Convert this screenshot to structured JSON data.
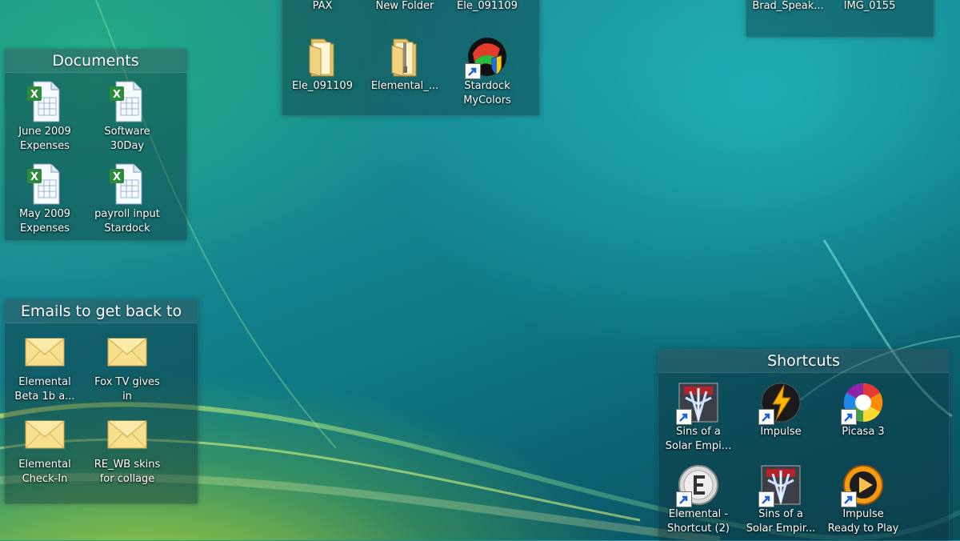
{
  "top_strip": {
    "labels": [
      "PAX",
      "New Folder",
      "Ele_091109"
    ]
  },
  "top_fence": {
    "items": [
      {
        "label": "Ele_091109",
        "icon": "folder-icon"
      },
      {
        "label": "Elemental_...",
        "icon": "zip-folder-icon"
      },
      {
        "label": "Stardock\nMyColors",
        "icon": "stardock-mycolors-icon"
      }
    ]
  },
  "top_right_fence": {
    "labels": [
      "Brad_Speak...",
      "IMG_0155"
    ]
  },
  "documents": {
    "title": "Documents",
    "items": [
      {
        "label": "June 2009\nExpenses",
        "icon": "excel-document-icon"
      },
      {
        "label": "Software\n30Day",
        "icon": "excel-document-icon"
      },
      {
        "label": "May 2009\nExpenses",
        "icon": "excel-document-icon"
      },
      {
        "label": "payroll input\nStardock",
        "icon": "excel-document-icon"
      }
    ]
  },
  "emails": {
    "title": "Emails to get back to",
    "items": [
      {
        "label": "Elemental\nBeta 1b a...",
        "icon": "envelope-icon"
      },
      {
        "label": "Fox TV gives\nin",
        "icon": "envelope-icon"
      },
      {
        "label": "Elemental\nCheck-In",
        "icon": "envelope-icon"
      },
      {
        "label": "RE_WB skins\nfor collage",
        "icon": "envelope-icon"
      }
    ]
  },
  "shortcuts": {
    "title": "Shortcuts",
    "items": [
      {
        "label": "Sins of a\nSolar Empi...",
        "icon": "sins-of-a-solar-empire-icon"
      },
      {
        "label": "Impulse",
        "icon": "impulse-icon"
      },
      {
        "label": "Picasa 3",
        "icon": "picasa-icon"
      },
      {
        "label": "Elemental -\nShortcut (2)",
        "icon": "elemental-icon"
      },
      {
        "label": "Sins of a\nSolar Empir...",
        "icon": "sins-of-a-solar-empire-icon"
      },
      {
        "label": "Impulse\nReady to Play",
        "icon": "impulse-ready-to-play-icon"
      }
    ]
  }
}
